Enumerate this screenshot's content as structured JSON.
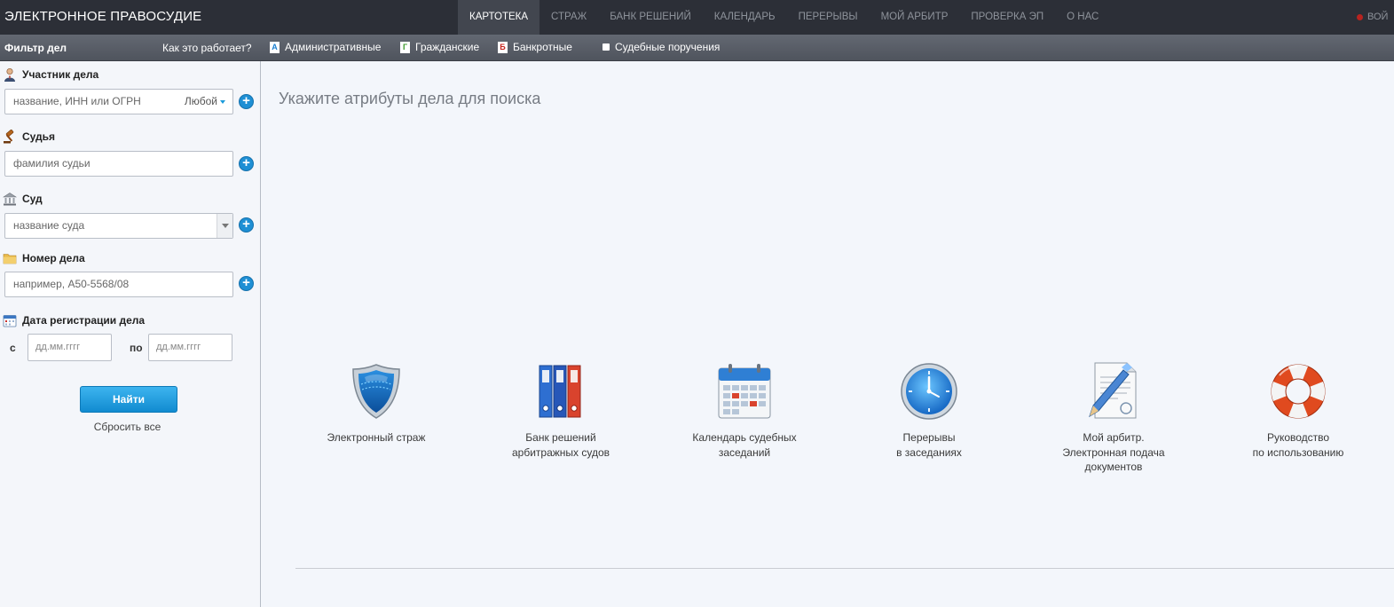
{
  "header": {
    "brand": "ЭЛЕКТРОННОЕ ПРАВОСУДИЕ",
    "nav": [
      {
        "label": "КАРТОТЕКА",
        "active": true
      },
      {
        "label": "СТРАЖ"
      },
      {
        "label": "БАНК РЕШЕНИЙ"
      },
      {
        "label": "КАЛЕНДАРЬ"
      },
      {
        "label": "ПЕРЕРЫВЫ"
      },
      {
        "label": "МОЙ АРБИТР"
      },
      {
        "label": "ПРОВЕРКА ЭП"
      },
      {
        "label": "О НАС"
      }
    ],
    "login_label": "ВОЙ"
  },
  "filterbar": {
    "title": "Фильтр дел",
    "howto": "Как это работает?",
    "categories": [
      {
        "letter": "А",
        "label": "Административные",
        "color": "#1a7fd1"
      },
      {
        "letter": "Г",
        "label": "Гражданские",
        "color": "#3d9a2c"
      },
      {
        "letter": "Б",
        "label": "Банкротные",
        "color": "#c8251e"
      },
      {
        "letter": "",
        "label": "Судебные поручения",
        "color": "#ffffff"
      }
    ]
  },
  "sidebar": {
    "participant": {
      "label": "Участник дела",
      "placeholder": "название, ИНН или ОГРН",
      "mode": "Любой",
      "icon": "person-icon"
    },
    "judge": {
      "label": "Судья",
      "placeholder": "фамилия судьи",
      "icon": "gavel-icon"
    },
    "court": {
      "label": "Суд",
      "placeholder": "название суда",
      "icon": "courthouse-icon"
    },
    "case_number": {
      "label": "Номер дела",
      "placeholder": "например, А50-5568/08",
      "icon": "folder-icon"
    },
    "reg_date": {
      "label": "Дата регистрации дела",
      "from_label": "с",
      "to_label": "по",
      "from_placeholder": "дд.мм.гггг",
      "to_placeholder": "дд.мм.гггг",
      "icon": "calendar-icon"
    },
    "find_button": "Найти",
    "reset_link": "Сбросить все"
  },
  "main": {
    "title": "Укажите атрибуты дела для поиска",
    "tiles": [
      {
        "icon": "shield-icon",
        "lines": [
          "Электронный страж"
        ]
      },
      {
        "icon": "binders-icon",
        "lines": [
          "Банк решений",
          "арбитражных судов"
        ]
      },
      {
        "icon": "calendar-icon",
        "lines": [
          "Календарь судебных",
          "заседаний"
        ]
      },
      {
        "icon": "clock-icon",
        "lines": [
          "Перерывы",
          "в заседаниях"
        ]
      },
      {
        "icon": "document-pen-icon",
        "lines": [
          "Мой арбитр.",
          "Электронная подача",
          "документов"
        ]
      },
      {
        "icon": "lifebuoy-icon",
        "lines": [
          "Руководство",
          "по использованию"
        ]
      }
    ]
  }
}
